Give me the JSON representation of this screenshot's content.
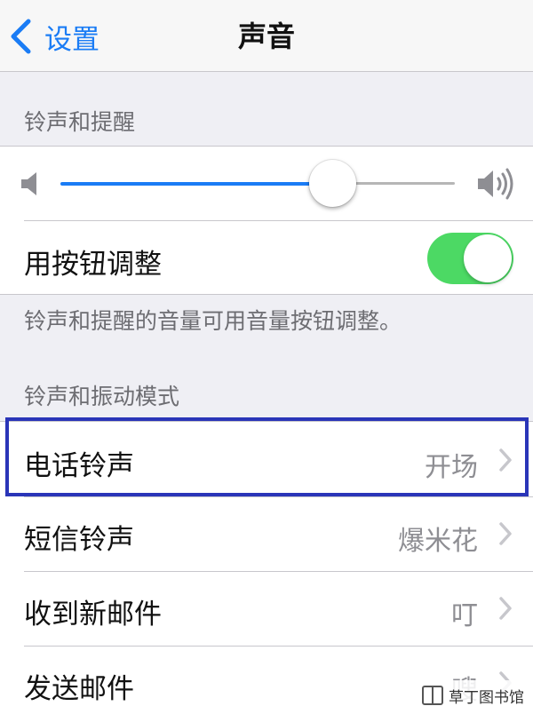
{
  "nav": {
    "back_label": "设置",
    "title": "声音"
  },
  "ringer_section": {
    "header": "铃声和提醒",
    "volume_fraction": 0.69,
    "toggle_label": "用按钮调整",
    "toggle_on": true,
    "footer": "铃声和提醒的音量可用音量按钮调整。"
  },
  "patterns_section": {
    "header": "铃声和振动模式",
    "rows": [
      {
        "label": "电话铃声",
        "value": "开场"
      },
      {
        "label": "短信铃声",
        "value": "爆米花"
      },
      {
        "label": "收到新邮件",
        "value": "叮"
      },
      {
        "label": "发送邮件",
        "value": "嗖"
      }
    ]
  },
  "colors": {
    "accent": "#1a7cf5",
    "toggle_on": "#4cd964",
    "highlight": "#2a35b8"
  },
  "watermark": {
    "text": "草丁图书馆"
  }
}
